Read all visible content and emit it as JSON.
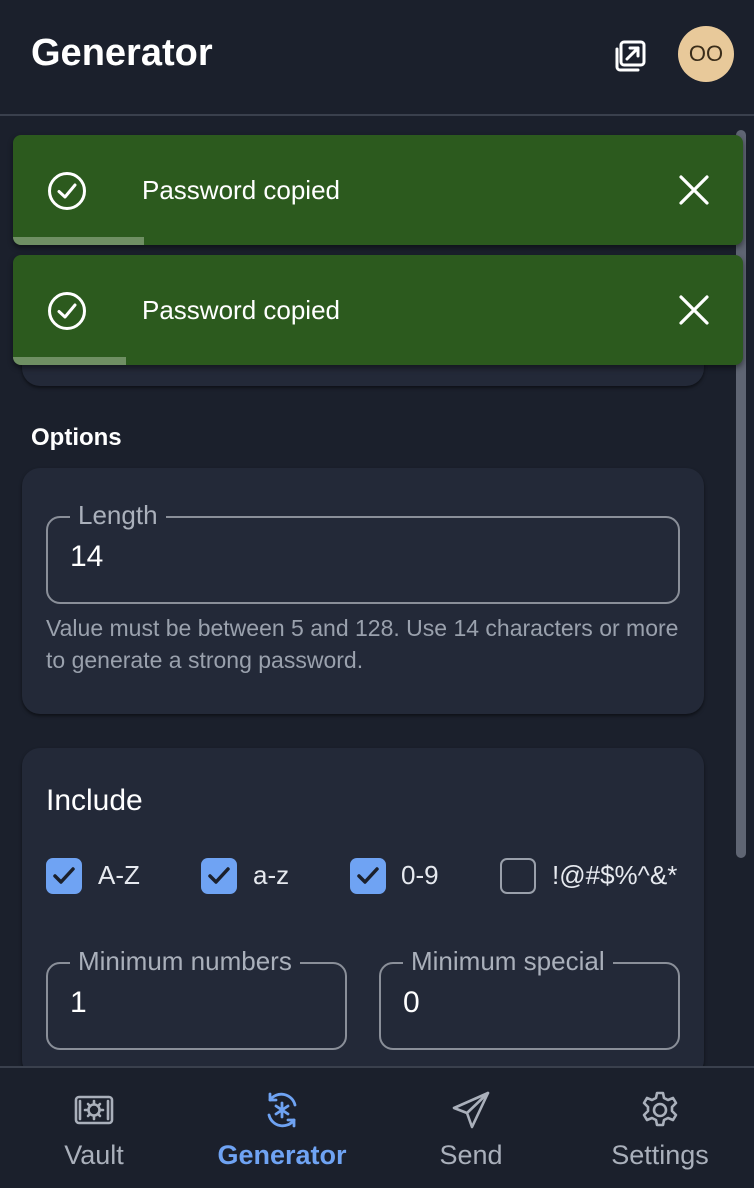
{
  "header": {
    "title": "Generator",
    "avatar_initials": "OO",
    "popout_icon": "popout-icon"
  },
  "toasts": [
    {
      "message": "Password copied",
      "icon": "check-circle-icon",
      "close_icon": "close-icon",
      "progress": 0.18
    },
    {
      "message": "Password copied",
      "icon": "check-circle-icon",
      "close_icon": "close-icon",
      "progress": 0.155
    }
  ],
  "options": {
    "title": "Options",
    "length": {
      "label": "Length",
      "value": "14",
      "hint": "Value must be between 5 and 128. Use 14 characters or more to generate a strong password."
    },
    "include": {
      "title": "Include",
      "checkboxes": [
        {
          "label": "A-Z",
          "checked": true
        },
        {
          "label": "a-z",
          "checked": true
        },
        {
          "label": "0-9",
          "checked": true
        },
        {
          "label": "!@#$%^&*",
          "checked": false
        }
      ],
      "min_numbers": {
        "label": "Minimum numbers",
        "value": "1"
      },
      "min_special": {
        "label": "Minimum special",
        "value": "0"
      }
    }
  },
  "nav": {
    "active": "Generator",
    "items": [
      {
        "label": "Vault",
        "icon": "vault-icon"
      },
      {
        "label": "Generator",
        "icon": "generator-icon"
      },
      {
        "label": "Send",
        "icon": "send-icon"
      },
      {
        "label": "Settings",
        "icon": "settings-icon"
      }
    ]
  },
  "colors": {
    "background": "#1b202c",
    "card": "#232938",
    "accent": "#6fa3f3",
    "toast_success": "#2c5a1e",
    "avatar": "#e8c99a"
  }
}
